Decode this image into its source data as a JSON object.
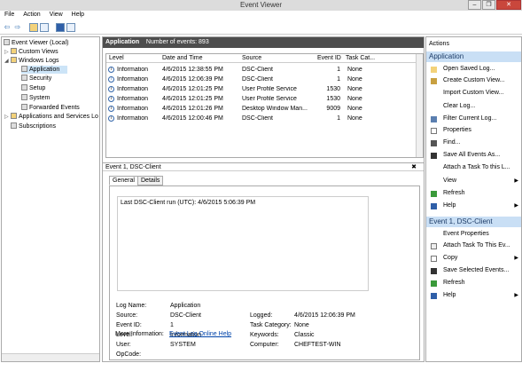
{
  "window": {
    "title": "Event Viewer"
  },
  "menu": [
    "File",
    "Action",
    "View",
    "Help"
  ],
  "tree": {
    "root": "Event Viewer (Local)",
    "custom_views": "Custom Views",
    "windows_logs": "Windows Logs",
    "logs": [
      "Application",
      "Security",
      "Setup",
      "System",
      "Forwarded Events"
    ],
    "app_services": "Applications and Services Lo",
    "subscriptions": "Subscriptions"
  },
  "main": {
    "header_name": "Application",
    "header_count": "Number of events: 893",
    "columns": [
      "Level",
      "Date and Time",
      "Source",
      "Event ID",
      "Task Cat..."
    ],
    "rows": [
      {
        "level": "Information",
        "date": "4/6/2015 12:38:55 PM",
        "source": "DSC-Client",
        "id": "1",
        "task": "None"
      },
      {
        "level": "Information",
        "date": "4/6/2015 12:06:39 PM",
        "source": "DSC-Client",
        "id": "1",
        "task": "None"
      },
      {
        "level": "Information",
        "date": "4/6/2015 12:01:25 PM",
        "source": "User Profile Service",
        "id": "1530",
        "task": "None"
      },
      {
        "level": "Information",
        "date": "4/6/2015 12:01:25 PM",
        "source": "User Profile Service",
        "id": "1530",
        "task": "None"
      },
      {
        "level": "Information",
        "date": "4/6/2015 12:01:26 PM",
        "source": "Desktop Window Man...",
        "id": "9009",
        "task": "None"
      },
      {
        "level": "Information",
        "date": "4/6/2015 12:00:46 PM",
        "source": "DSC-Client",
        "id": "1",
        "task": "None"
      }
    ]
  },
  "detail": {
    "title": "Event 1, DSC-Client",
    "close": "✖",
    "tabs": [
      "General",
      "Details"
    ],
    "description": "Last DSC-Client run (UTC): 4/6/2015 5:06:39 PM",
    "labels": {
      "log_name": "Log Name:",
      "source": "Source:",
      "event_id": "Event ID:",
      "level": "Level:",
      "user": "User:",
      "opcode": "OpCode:",
      "more_info": "More Information:",
      "logged": "Logged:",
      "task_category": "Task Category:",
      "keywords": "Keywords:",
      "computer": "Computer:"
    },
    "values": {
      "log_name": "Application",
      "source": "DSC-Client",
      "event_id": "1",
      "level": "Information",
      "user": "SYSTEM",
      "opcode": "",
      "more_info": "Event Log Online Help",
      "logged": "4/6/2015 12:06:39 PM",
      "task_category": "None",
      "keywords": "Classic",
      "computer": "CHEFTEST-WIN"
    }
  },
  "actions": {
    "header": "Actions",
    "section1": "Application",
    "items1": [
      "Open Saved Log...",
      "Create Custom View...",
      "Import Custom View...",
      "Clear Log...",
      "Filter Current Log...",
      "Properties",
      "Find...",
      "Save All Events As...",
      "Attach a Task To this L...",
      "View",
      "Refresh",
      "Help"
    ],
    "section2": "Event 1, DSC-Client",
    "items2": [
      "Event Properties",
      "Attach Task To This Ev...",
      "Copy",
      "Save Selected Events...",
      "Refresh",
      "Help"
    ]
  },
  "colors": {
    "selection": "#3399ff",
    "header": "#4d4d4d",
    "action_section": "#c9dff5"
  }
}
